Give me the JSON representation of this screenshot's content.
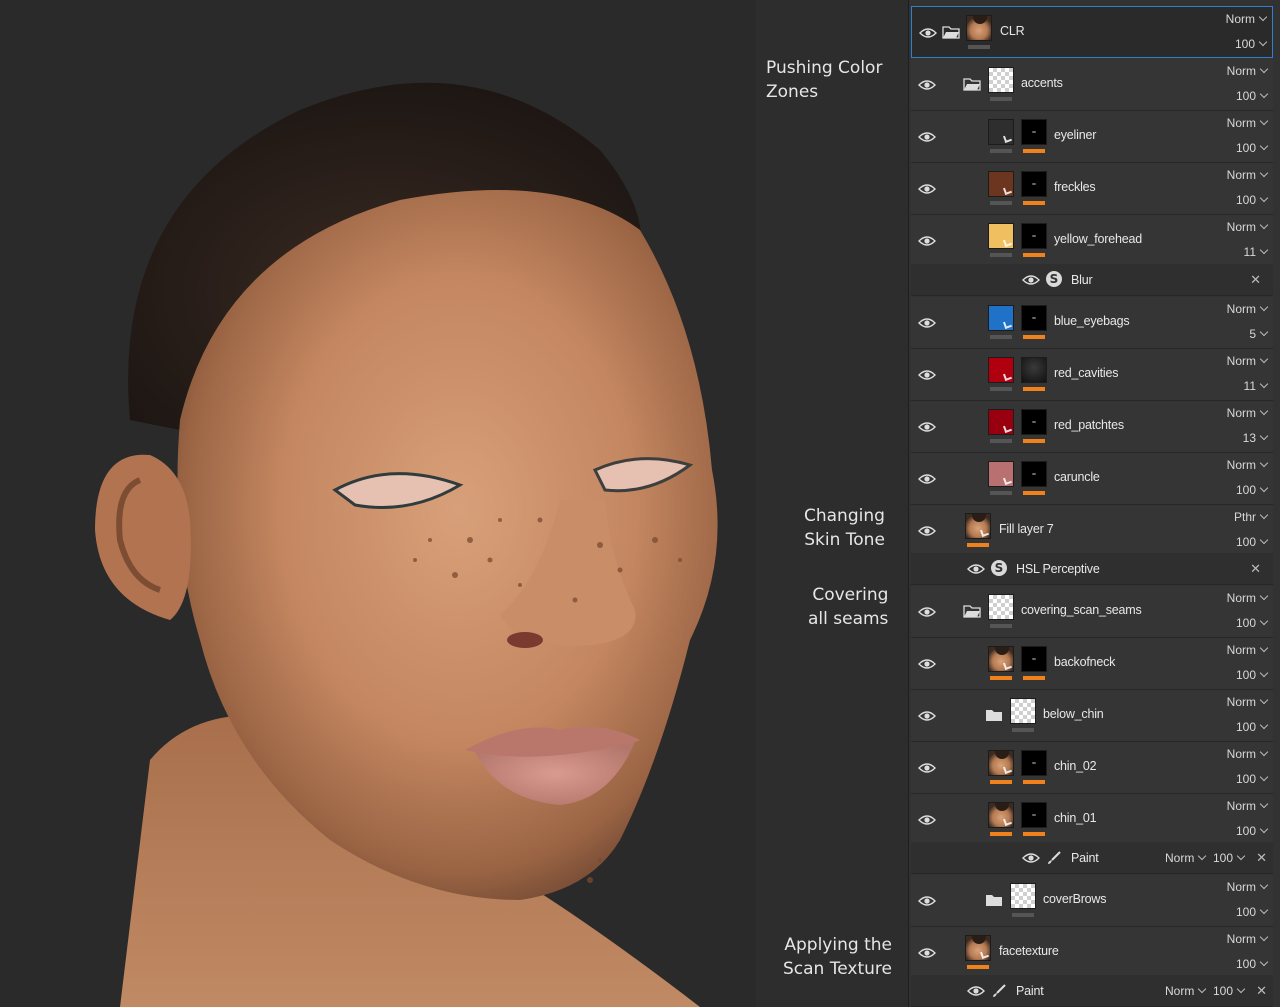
{
  "annotations": [
    {
      "lines": [
        "Pushing Color",
        "Zones"
      ]
    },
    {
      "lines": [
        "Changing",
        "Skin Tone"
      ]
    },
    {
      "lines": [
        "Covering",
        "all seams"
      ]
    },
    {
      "lines": [
        "Applying the",
        "Scan Texture"
      ]
    }
  ],
  "layers": [
    {
      "name": "CLR",
      "blend": "Norm",
      "opacity": "100"
    },
    {
      "name": "accents",
      "blend": "Norm",
      "opacity": "100"
    },
    {
      "name": "eyeliner",
      "blend": "Norm",
      "opacity": "100"
    },
    {
      "name": "freckles",
      "blend": "Norm",
      "opacity": "100"
    },
    {
      "name": "yellow_forehead",
      "blend": "Norm",
      "opacity": "11"
    },
    {
      "name": "Blur"
    },
    {
      "name": "blue_eyebags",
      "blend": "Norm",
      "opacity": "5"
    },
    {
      "name": "red_cavities",
      "blend": "Norm",
      "opacity": "11"
    },
    {
      "name": "red_patchtes",
      "blend": "Norm",
      "opacity": "13"
    },
    {
      "name": "caruncle",
      "blend": "Norm",
      "opacity": "100"
    },
    {
      "name": "Fill layer 7",
      "blend": "Pthr",
      "opacity": "100"
    },
    {
      "name": "HSL Perceptive"
    },
    {
      "name": "covering_scan_seams",
      "blend": "Norm",
      "opacity": "100"
    },
    {
      "name": "backofneck",
      "blend": "Norm",
      "opacity": "100"
    },
    {
      "name": "below_chin",
      "blend": "Norm",
      "opacity": "100"
    },
    {
      "name": "chin_02",
      "blend": "Norm",
      "opacity": "100"
    },
    {
      "name": "chin_01",
      "blend": "Norm",
      "opacity": "100"
    },
    {
      "name": "Paint",
      "blend": "Norm",
      "opacity": "100"
    },
    {
      "name": "coverBrows",
      "blend": "Norm",
      "opacity": "100"
    },
    {
      "name": "facetexture",
      "blend": "Norm",
      "opacity": "100"
    },
    {
      "name": "Paint",
      "blend": "Norm",
      "opacity": "100"
    }
  ],
  "swatches": {
    "eyeliner": "#2e2e2e",
    "freckles": "#6b3520",
    "yellow_forehead": "#f0c060",
    "blue_eyebags": "#1f72c8",
    "red_cavities": "#b00010",
    "red_patchtes": "#980010",
    "caruncle": "#b87070",
    "accent": "#f0821e",
    "selection": "#2d7fd0"
  }
}
